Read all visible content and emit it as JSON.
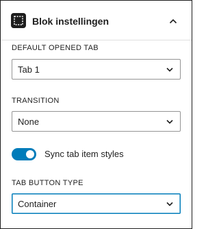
{
  "panel": {
    "title": "Blok instellingen",
    "icon": "block-selection-icon",
    "expanded": true
  },
  "fields": {
    "default_tab": {
      "label": "DEFAULT OPENED TAB",
      "value": "Tab 1"
    },
    "transition": {
      "label": "TRANSITION",
      "value": "None"
    },
    "sync_styles": {
      "label": "Sync tab item styles",
      "checked": true
    },
    "tab_button_type": {
      "label": "TAB BUTTON TYPE",
      "value": "Container"
    }
  },
  "colors": {
    "accent": "#007cba",
    "text": "#1e1e1e",
    "border": "#949494"
  }
}
